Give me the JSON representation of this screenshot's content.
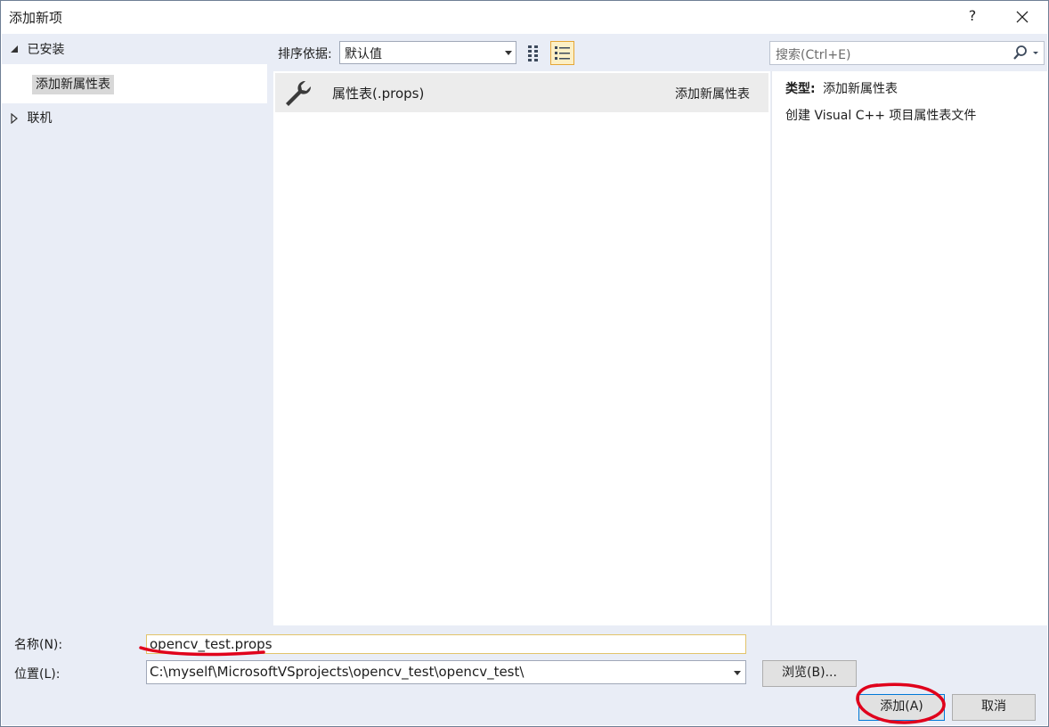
{
  "window": {
    "title": "添加新项",
    "help": "?",
    "close_icon": "close-icon"
  },
  "sidebar": {
    "installed": "已安装",
    "selected_item": "添加新属性表",
    "online": "联机"
  },
  "toolbar": {
    "sort_label": "排序依据:",
    "sort_value": "默认值",
    "view_grid_icon": "grid-view-icon",
    "view_list_icon": "list-view-icon",
    "search_placeholder": "搜索(Ctrl+E)"
  },
  "templates": [
    {
      "icon": "wrench-icon",
      "name": "属性表(.props)",
      "category": "添加新属性表"
    }
  ],
  "details": {
    "type_label": "类型:",
    "type_value": "添加新属性表",
    "description": "创建 Visual C++ 项目属性表文件"
  },
  "form": {
    "name_label": "名称(N):",
    "name_value": "opencv_test.props",
    "location_label": "位置(L):",
    "location_value": "C:\\myself\\MicrosoftVSprojects\\opencv_test\\opencv_test\\",
    "browse_label": "浏览(B)...",
    "add_label": "添加(A)",
    "cancel_label": "取消"
  },
  "colors": {
    "annotation": "#e0001b",
    "accent": "#0078d7",
    "selection": "#fcefc5"
  }
}
